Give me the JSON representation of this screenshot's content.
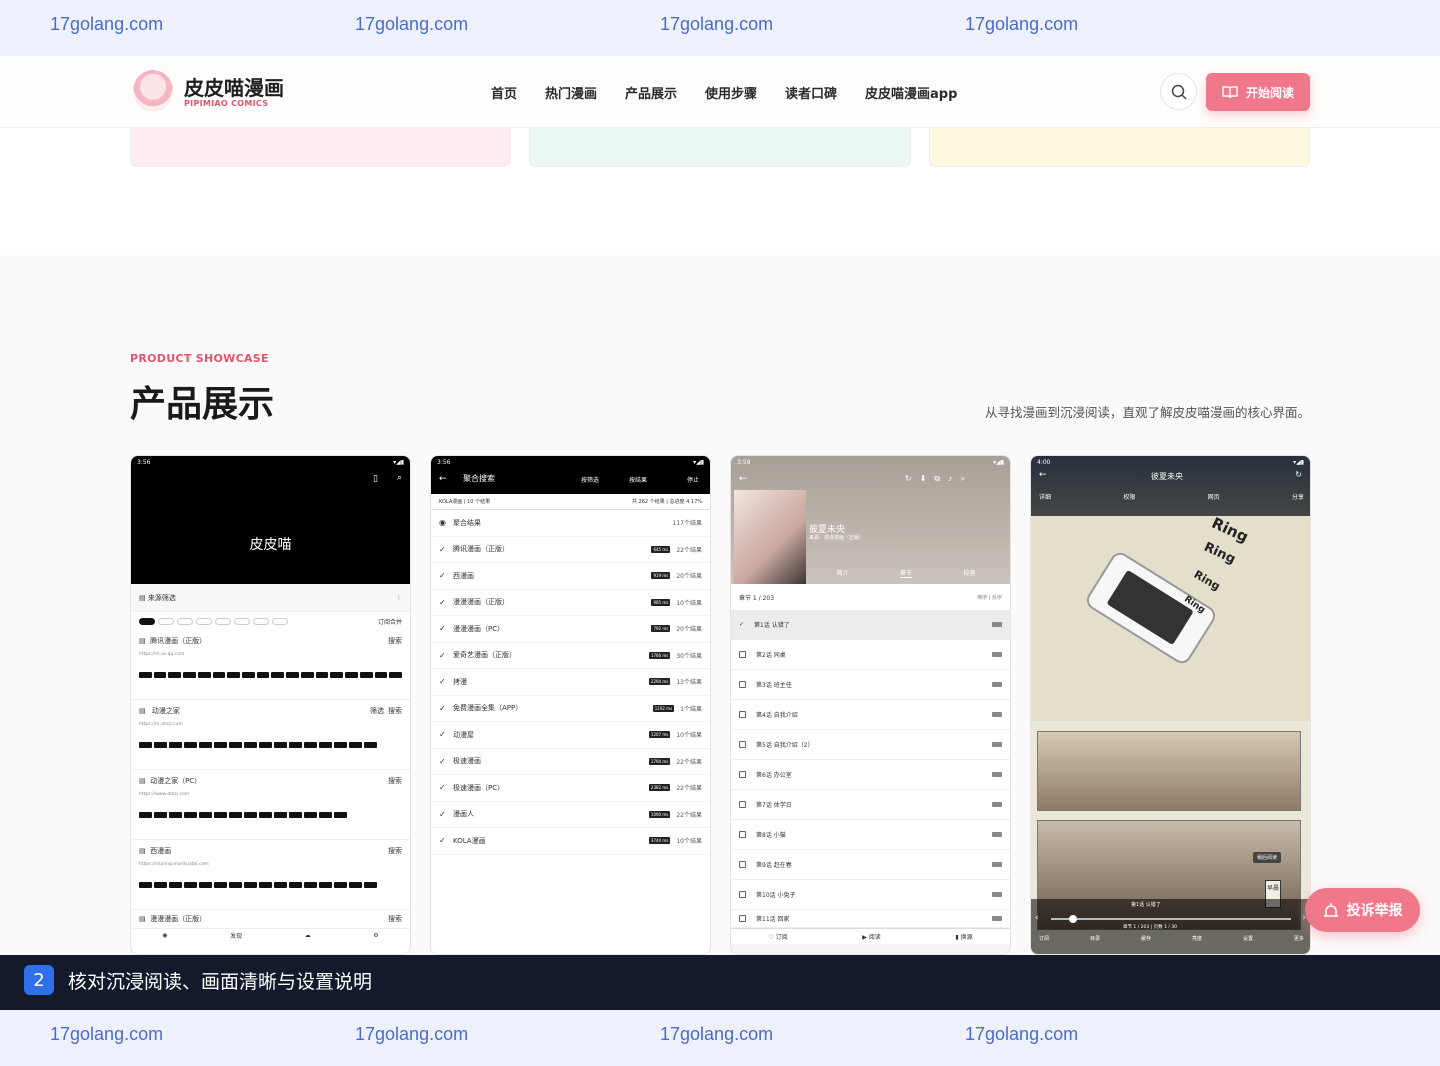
{
  "watermark": {
    "text": [
      "17golang.com",
      "17golang.com",
      "17golang.com",
      "17golang.com"
    ]
  },
  "header": {
    "brand_title": "皮皮喵漫画",
    "brand_sub": "PIPIMIAO COMICS",
    "nav": [
      "首页",
      "热门漫画",
      "产品展示",
      "使用步骤",
      "读者口碑",
      "皮皮喵漫画app"
    ],
    "search_icon": "search-icon",
    "cta_label": "开始阅读",
    "cta_icon": "book-open-icon"
  },
  "colors": {
    "accent": "#f0788b",
    "brand_red": "#e2566d",
    "dark": "#131a2b",
    "badge_blue": "#2f6fe8"
  },
  "showcase": {
    "eyebrow": "PRODUCT SHOWCASE",
    "title": "产品展示",
    "desc": "从寻找漫画到沉浸阅读，直观了解皮皮喵漫画的核心界面。"
  },
  "phone1": {
    "time": "3:56",
    "banner": "皮皮喵",
    "filter_label": "来源筛选",
    "sources": [
      {
        "name": "腾讯漫画（正版）",
        "url": "https://m.ac.qq.com",
        "action": "搜索"
      },
      {
        "name": "动漫之家",
        "url": "https://m.dmzj.com",
        "action": "搜索",
        "filter": "筛选"
      },
      {
        "name": "动漫之家（PC）",
        "url": "https://www.dmzj.com",
        "action": "搜索"
      },
      {
        "name": "西漫画",
        "url": "https://sharing.manhuatai.com",
        "action": "搜索"
      },
      {
        "name": "漫漫漫画（正版）",
        "url": "",
        "action": "搜索"
      }
    ],
    "sort_label": "订阅合并",
    "bottom_tab": "发现"
  },
  "phone2": {
    "time": "3:56",
    "title": "聚合搜索",
    "sub": "KOLA漫画 | 10 个结果",
    "stats": "共 262 个结果 | 总进度 4.17%",
    "actions": [
      "按筛选",
      "按结果",
      "停止"
    ],
    "results": [
      {
        "name": "聚合结果",
        "count": "117个结果",
        "tag": ""
      },
      {
        "name": "腾讯漫画（正版）",
        "count": "22个结果",
        "tag": "645 ms"
      },
      {
        "name": "西漫画",
        "count": "20个结果",
        "tag": "919 ms"
      },
      {
        "name": "漫漫漫画（正版）",
        "count": "10个结果",
        "tag": "985 ms"
      },
      {
        "name": "漫漫漫画（PC）",
        "count": "20个结果",
        "tag": "792 ms"
      },
      {
        "name": "爱奇艺漫画（正版）",
        "count": "30个结果",
        "tag": "1766 ms"
      },
      {
        "name": "拷漫",
        "count": "13个结果",
        "tag": "2294 ms"
      },
      {
        "name": "免费漫画全集（APP）",
        "count": "1个结果",
        "tag": "1192 ms"
      },
      {
        "name": "动漫屋",
        "count": "10个结果",
        "tag": "1207 ms"
      },
      {
        "name": "极速漫画",
        "count": "22个结果",
        "tag": "1794 ms"
      },
      {
        "name": "极速漫画（PC）",
        "count": "22个结果",
        "tag": "2382 ms"
      },
      {
        "name": "漫画人",
        "count": "22个结果",
        "tag": "1090 ms"
      },
      {
        "name": "KOLA漫画",
        "count": "10个结果",
        "tag": "3744 ms"
      }
    ]
  },
  "phone3": {
    "time": "3:59",
    "comic_title": "彼夏未央",
    "source": "来源：漫漫漫画（正版）",
    "tabs": [
      "简介",
      "章节",
      "段落"
    ],
    "chapter_info": "章节 1 / 203",
    "sort": "倒序 | 反序",
    "chapters": [
      "第1话 认错了",
      "第2话 同桌",
      "第3话 班主任",
      "第4话 自我介绍",
      "第5话 自我介绍（2）",
      "第6话 办公室",
      "第7话 体学日",
      "第8话 小猫",
      "第9话 赶在春",
      "第10话 小兔子",
      "第11话 回家"
    ],
    "bottom": [
      "订阅",
      "阅读",
      "换源"
    ]
  },
  "phone4": {
    "time": "4:00",
    "title": "彼夏未央",
    "actions": [
      "详细",
      "权限",
      "网页",
      "分享"
    ],
    "sfx": [
      "Ring",
      "Ring",
      "Ring",
      "Ring"
    ],
    "caption": "第1话 认错了",
    "badge": "稍后阅读",
    "side_label": "早晨",
    "page_info": "章节 1 / 203 | 页数 1 / 30",
    "bottom": [
      "订阅",
      "目录",
      "缓存",
      "亮度",
      "设置",
      "更多"
    ]
  },
  "footer_bar": {
    "badge": "2",
    "text": "核对沉浸阅读、画面清晰与设置说明"
  },
  "report": {
    "label": "投诉举报",
    "icon": "alarm-icon"
  }
}
